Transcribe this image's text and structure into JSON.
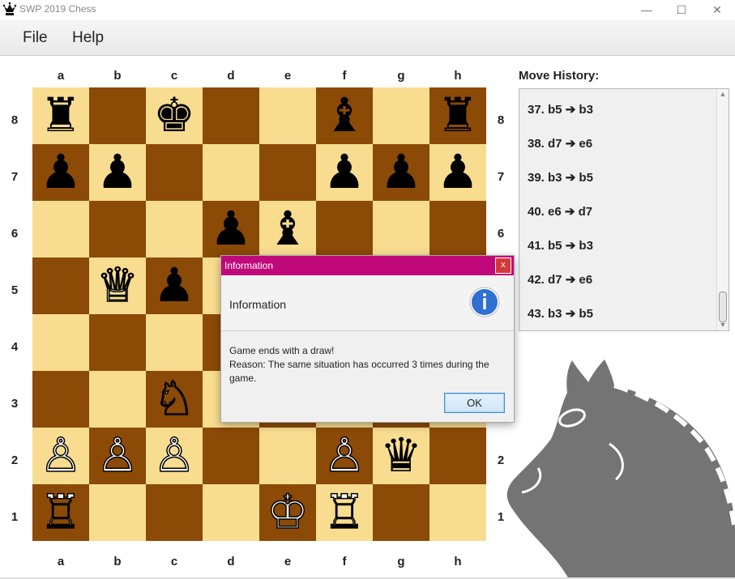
{
  "window": {
    "title": "SWP 2019 Chess",
    "minimize_icon": "minimize-icon",
    "maximize_icon": "maximize-icon",
    "close_icon": "close-icon"
  },
  "menu": {
    "items": [
      "File",
      "Help"
    ]
  },
  "board": {
    "files": [
      "a",
      "b",
      "c",
      "d",
      "e",
      "f",
      "g",
      "h"
    ],
    "ranks": [
      "8",
      "7",
      "6",
      "5",
      "4",
      "3",
      "2",
      "1"
    ],
    "colors": {
      "light": "#f8dd90",
      "dark": "#8b4a06"
    },
    "pieces": [
      {
        "square": "a8",
        "symbol": "♜",
        "color": "black"
      },
      {
        "square": "c8",
        "symbol": "♚",
        "color": "black"
      },
      {
        "square": "f8",
        "symbol": "♝",
        "color": "black"
      },
      {
        "square": "h8",
        "symbol": "♜",
        "color": "black"
      },
      {
        "square": "a7",
        "symbol": "♟",
        "color": "black"
      },
      {
        "square": "b7",
        "symbol": "♟",
        "color": "black"
      },
      {
        "square": "f7",
        "symbol": "♟",
        "color": "black"
      },
      {
        "square": "g7",
        "symbol": "♟",
        "color": "black"
      },
      {
        "square": "h7",
        "symbol": "♟",
        "color": "black"
      },
      {
        "square": "d6",
        "symbol": "♟",
        "color": "black"
      },
      {
        "square": "e6",
        "symbol": "♝",
        "color": "black"
      },
      {
        "square": "b5",
        "symbol": "♕",
        "color": "white"
      },
      {
        "square": "c5",
        "symbol": "♟",
        "color": "black"
      },
      {
        "square": "c3",
        "symbol": "♘",
        "color": "white"
      },
      {
        "square": "a2",
        "symbol": "♙",
        "color": "white"
      },
      {
        "square": "b2",
        "symbol": "♙",
        "color": "white"
      },
      {
        "square": "c2",
        "symbol": "♙",
        "color": "white"
      },
      {
        "square": "f2",
        "symbol": "♙",
        "color": "white"
      },
      {
        "square": "g2",
        "symbol": "♛",
        "color": "black"
      },
      {
        "square": "a1",
        "symbol": "♖",
        "color": "white"
      },
      {
        "square": "e1",
        "symbol": "♔",
        "color": "white"
      },
      {
        "square": "f1",
        "symbol": "♖",
        "color": "white"
      }
    ]
  },
  "move_history": {
    "title": "Move History:",
    "moves": [
      "37. b5 ➔ b3",
      "38. d7 ➔ e6",
      "39. b3 ➔ b5",
      "40. e6 ➔ d7",
      "41. b5 ➔ b3",
      "42. d7 ➔ e6",
      "43. b3 ➔ b5"
    ]
  },
  "dialog": {
    "title": "Information",
    "header": "Information",
    "icon": "info-icon",
    "message_line1": "Game ends with a draw!",
    "message_line2": "Reason: The same situation has occurred 3 times during the",
    "message_line3": "game.",
    "ok_label": "OK",
    "title_color": "#c0087a"
  },
  "decoration": {
    "logo": "knight-logo-icon"
  }
}
